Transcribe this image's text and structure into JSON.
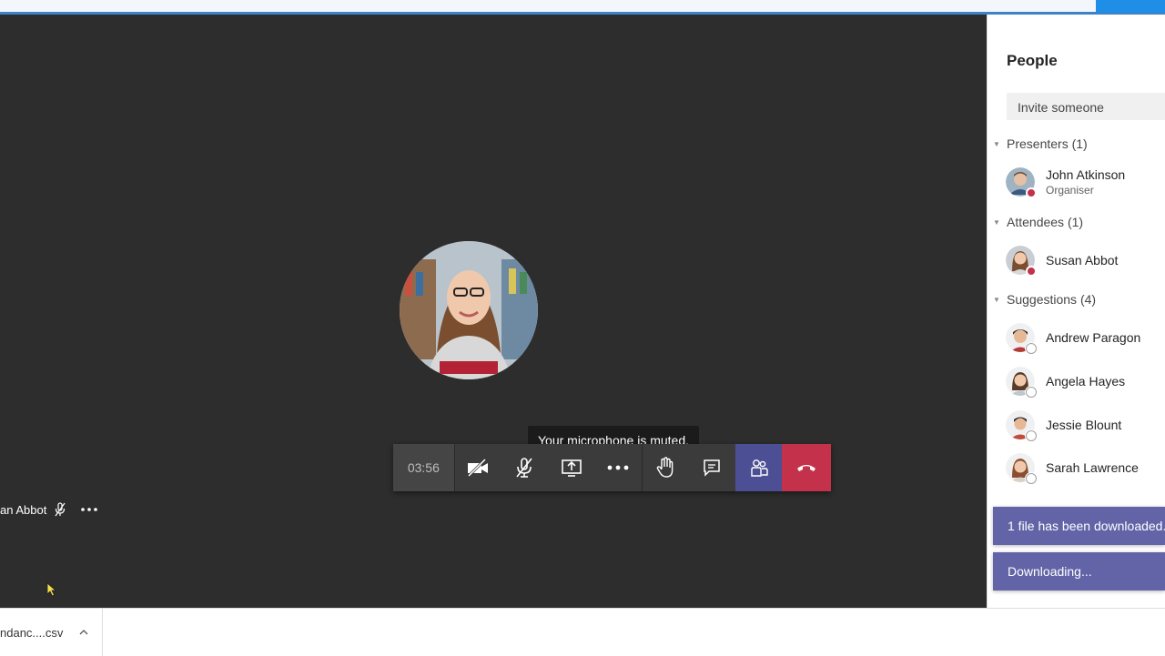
{
  "call": {
    "timer": "03:56",
    "tooltip": "Your microphone is muted.",
    "participant_name": "an Abbot",
    "buttons": [
      "camera-off",
      "mic-off",
      "share",
      "more",
      "raise-hand",
      "chat",
      "people",
      "hang-up"
    ]
  },
  "people_panel": {
    "title": "People",
    "invite_placeholder": "Invite someone",
    "presenters_label": "Presenters (1)",
    "attendees_label": "Attendees (1)",
    "suggestions_label": "Suggestions (4)",
    "presenters": [
      {
        "name": "John Atkinson",
        "role": "Organiser"
      }
    ],
    "attendees": [
      {
        "name": "Susan Abbot"
      }
    ],
    "suggestions": [
      {
        "name": "Andrew Paragon"
      },
      {
        "name": "Angela Hayes"
      },
      {
        "name": "Jessie Blount"
      },
      {
        "name": "Sarah Lawrence"
      }
    ]
  },
  "notifications": {
    "downloaded": "1 file has been downloaded.",
    "downloading": "Downloading..."
  },
  "download_bar": {
    "file_name": "ndanc....csv"
  },
  "colors": {
    "stage": "#2d2d2d",
    "accent": "#6264a7",
    "hangup": "#c4314b"
  }
}
